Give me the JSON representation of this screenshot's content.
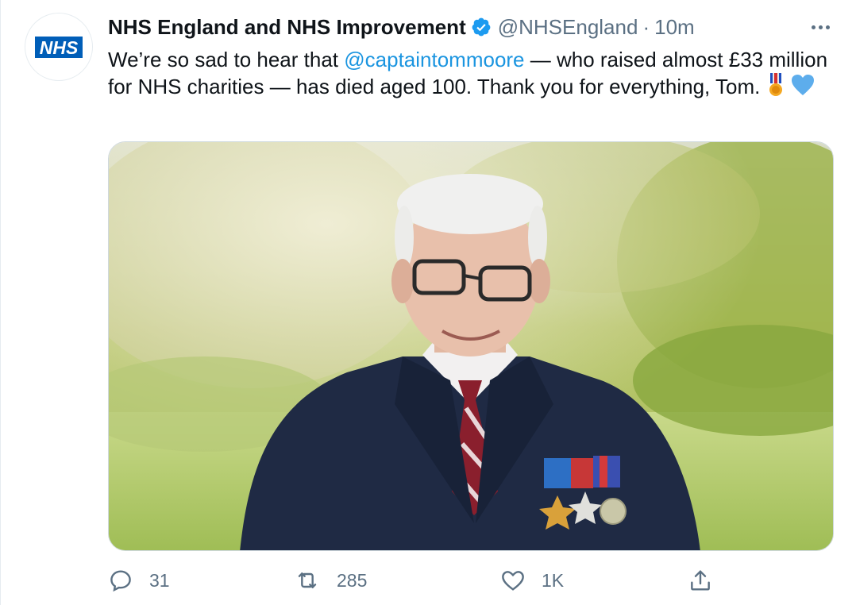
{
  "tweet": {
    "avatar_text": "NHS",
    "display_name": "NHS England and NHS Improvement",
    "handle": "@NHSEngland",
    "separator": "·",
    "time": "10m",
    "text_before": "We’re so sad to hear that ",
    "mention": "@captaintommoore",
    "text_after": " — who raised almost £33 million for NHS charities — has died aged 100. Thank you for everything, Tom.",
    "emojis": [
      "military-medal-emoji",
      "blue-heart-emoji"
    ],
    "image_description_icon": "photo",
    "actions": {
      "reply_count": "31",
      "retweet_count": "285",
      "like_count": "1K"
    }
  },
  "colors": {
    "accent": "#1b95e0",
    "verified": "#1d9bf0",
    "muted": "#5b7083",
    "nhs_blue": "#005eb8"
  },
  "icons": [
    "verified-badge-icon",
    "more-icon",
    "reply-icon",
    "retweet-icon",
    "like-icon",
    "share-icon"
  ]
}
